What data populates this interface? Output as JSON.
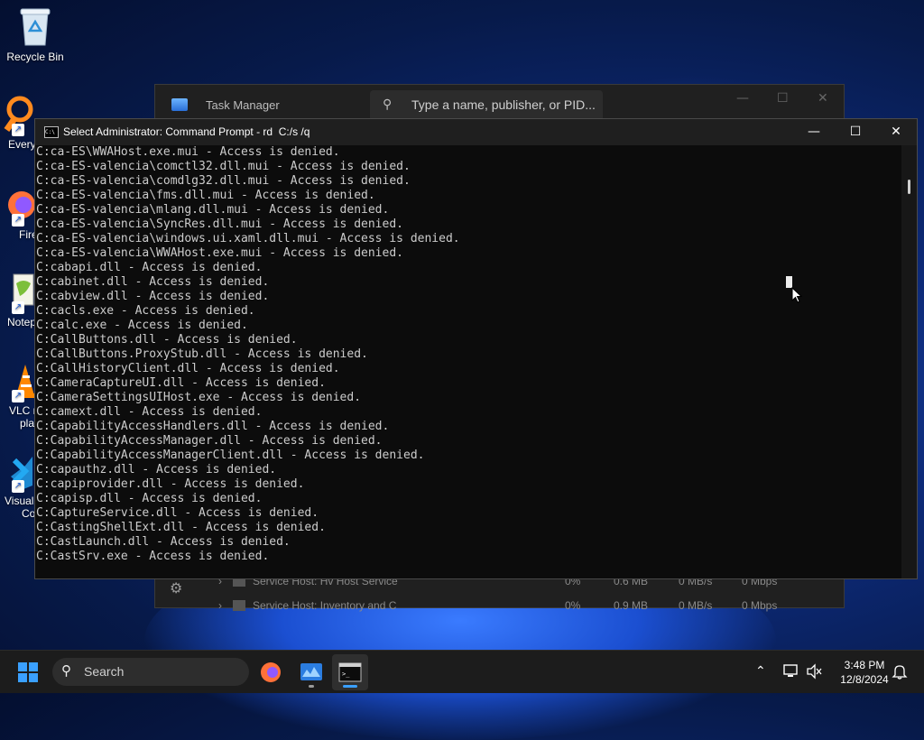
{
  "desktop": {
    "icons": [
      {
        "label": "Recycle Bin",
        "icon": "recycle-bin-icon"
      },
      {
        "label": "Every",
        "icon": "everything-search-icon"
      },
      {
        "label": "Fire",
        "icon": "firefox-icon"
      },
      {
        "label": "Notep",
        "icon": "notepad-plus-plus-icon"
      },
      {
        "label": "VLC m",
        "label2": "pla",
        "icon": "vlc-icon"
      },
      {
        "label": "Visual",
        "label2": "Co",
        "icon": "vscode-icon"
      }
    ]
  },
  "task_manager": {
    "title": "Task Manager",
    "search_placeholder": "Type a name, publisher, or PID...",
    "rows": [
      {
        "name": "Service Host: Hv Host Service",
        "cpu": "0%",
        "memory": "0.6 MB",
        "disk": "0 MB/s",
        "network": "0 Mbps"
      },
      {
        "name": "Service Host: Inventory and C",
        "cpu": "0%",
        "memory": "0.9 MB",
        "disk": "0 MB/s",
        "network": "0 Mbps"
      }
    ]
  },
  "cmd": {
    "title": "Select Administrator: Command Prompt - rd  C:/s /q",
    "minimize": "—",
    "maximize": "☐",
    "close": "✕",
    "lines": [
      "C:ca-ES\\WWAHost.exe.mui - Access is denied.",
      "C:ca-ES-valencia\\comctl32.dll.mui - Access is denied.",
      "C:ca-ES-valencia\\comdlg32.dll.mui - Access is denied.",
      "C:ca-ES-valencia\\fms.dll.mui - Access is denied.",
      "C:ca-ES-valencia\\mlang.dll.mui - Access is denied.",
      "C:ca-ES-valencia\\SyncRes.dll.mui - Access is denied.",
      "C:ca-ES-valencia\\windows.ui.xaml.dll.mui - Access is denied.",
      "C:ca-ES-valencia\\WWAHost.exe.mui - Access is denied.",
      "C:cabapi.dll - Access is denied.",
      "C:cabinet.dll - Access is denied.",
      "C:cabview.dll - Access is denied.",
      "C:cacls.exe - Access is denied.",
      "C:calc.exe - Access is denied.",
      "C:CallButtons.dll - Access is denied.",
      "C:CallButtons.ProxyStub.dll - Access is denied.",
      "C:CallHistoryClient.dll - Access is denied.",
      "C:CameraCaptureUI.dll - Access is denied.",
      "C:CameraSettingsUIHost.exe - Access is denied.",
      "C:camext.dll - Access is denied.",
      "C:CapabilityAccessHandlers.dll - Access is denied.",
      "C:CapabilityAccessManager.dll - Access is denied.",
      "C:CapabilityAccessManagerClient.dll - Access is denied.",
      "C:capauthz.dll - Access is denied.",
      "C:capiprovider.dll - Access is denied.",
      "C:capisp.dll - Access is denied.",
      "C:CaptureService.dll - Access is denied.",
      "C:CastingShellExt.dll - Access is denied.",
      "C:CastLaunch.dll - Access is denied.",
      "C:CastSrv.exe - Access is denied."
    ]
  },
  "taskbar": {
    "search_label": "Search",
    "apps": [
      {
        "name": "firefox-taskbar-icon",
        "active": false
      },
      {
        "name": "task-manager-taskbar-icon",
        "active": false
      },
      {
        "name": "command-prompt-taskbar-icon",
        "active": true
      }
    ],
    "time": "3:48 PM",
    "date": "12/8/2024",
    "accent": "#3aa0ff"
  }
}
